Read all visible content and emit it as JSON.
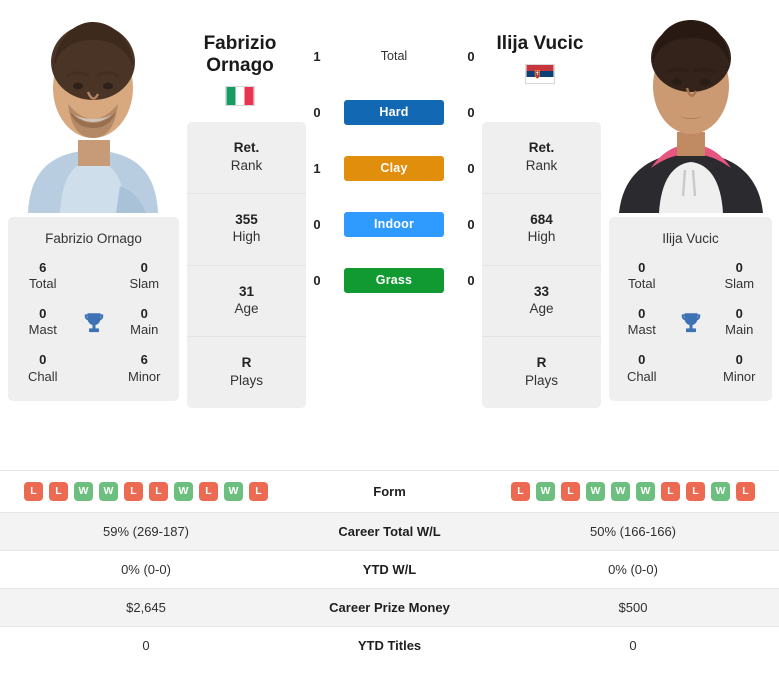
{
  "players": {
    "left": {
      "first_name": "Fabrizio",
      "last_name": "Ornago",
      "full_name": "Fabrizio Ornago",
      "country_flag": "italy-flag",
      "titles": {
        "total_value": "6",
        "total_label": "Total",
        "slam_value": "0",
        "slam_label": "Slam",
        "mast_value": "0",
        "mast_label": "Mast",
        "main_value": "0",
        "main_label": "Main",
        "chall_value": "0",
        "chall_label": "Chall",
        "minor_value": "6",
        "minor_label": "Minor"
      },
      "rank_rows": [
        {
          "value": "Ret.",
          "label": "Rank"
        },
        {
          "value": "355",
          "label": "High"
        },
        {
          "value": "31",
          "label": "Age"
        },
        {
          "value": "R",
          "label": "Plays"
        }
      ],
      "form": [
        "L",
        "L",
        "W",
        "W",
        "L",
        "L",
        "W",
        "L",
        "W",
        "L"
      ],
      "career_total_wl": "59% (269-187)",
      "ytd_wl": "0% (0-0)",
      "career_prize_money": "$2,645",
      "ytd_titles": "0"
    },
    "right": {
      "first_name": "Ilija",
      "last_name": "Vucic",
      "full_name": "Ilija Vucic",
      "country_flag": "serbia-flag",
      "titles": {
        "total_value": "0",
        "total_label": "Total",
        "slam_value": "0",
        "slam_label": "Slam",
        "mast_value": "0",
        "mast_label": "Mast",
        "main_value": "0",
        "main_label": "Main",
        "chall_value": "0",
        "chall_label": "Chall",
        "minor_value": "0",
        "minor_label": "Minor"
      },
      "rank_rows": [
        {
          "value": "Ret.",
          "label": "Rank"
        },
        {
          "value": "684",
          "label": "High"
        },
        {
          "value": "33",
          "label": "Age"
        },
        {
          "value": "R",
          "label": "Plays"
        }
      ],
      "form": [
        "L",
        "W",
        "L",
        "W",
        "W",
        "W",
        "L",
        "L",
        "W",
        "L"
      ],
      "career_total_wl": "50% (166-166)",
      "ytd_wl": "0% (0-0)",
      "career_prize_money": "$500",
      "ytd_titles": "0"
    }
  },
  "head_to_head": {
    "total": {
      "label": "Total",
      "left": "1",
      "right": "0"
    },
    "surfaces": [
      {
        "label": "Hard",
        "left": "0",
        "right": "0",
        "color": "#1268b3"
      },
      {
        "label": "Clay",
        "left": "1",
        "right": "0",
        "color": "#e08e0b"
      },
      {
        "label": "Indoor",
        "left": "0",
        "right": "0",
        "color": "#2f9aff"
      },
      {
        "label": "Grass",
        "left": "0",
        "right": "0",
        "color": "#119932"
      }
    ]
  },
  "stats_rows": [
    {
      "label": "Form"
    },
    {
      "label": "Career Total W/L"
    },
    {
      "label": "YTD W/L"
    },
    {
      "label": "Career Prize Money"
    },
    {
      "label": "YTD Titles"
    }
  ],
  "colors": {
    "card_bg": "#efefef",
    "win_badge": "#6cbf7e",
    "loss_badge": "#ec6a52",
    "row_alt": "#f3f3f3"
  }
}
